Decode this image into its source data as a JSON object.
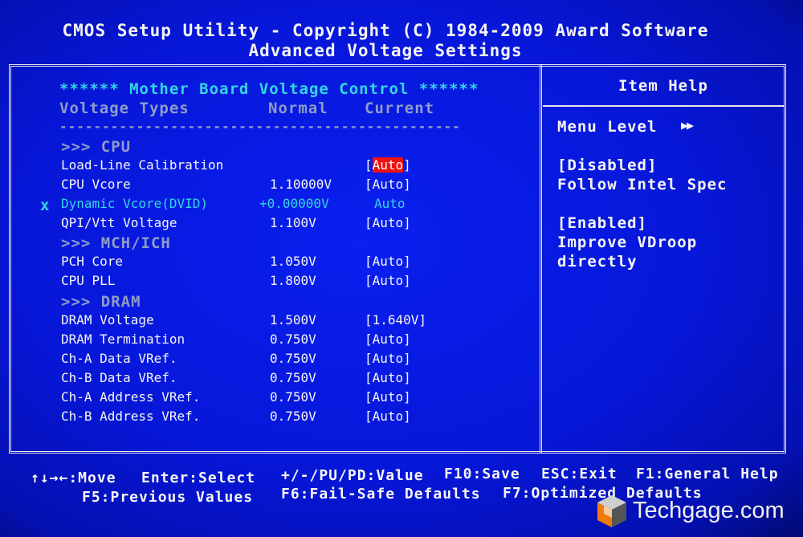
{
  "header": {
    "title": "CMOS Setup Utility - Copyright (C) 1984-2009 Award Software",
    "subtitle": "Advanced Voltage Settings"
  },
  "main": {
    "section_title": "****** Mother Board Voltage Control ******",
    "columns": {
      "type": "Voltage Types",
      "normal": "Normal",
      "current": "Current"
    },
    "separator": "-----------------------------------------------",
    "groups": {
      "cpu": ">>> CPU",
      "mch": ">>> MCH/ICH",
      "dram": ">>> DRAM"
    },
    "items": [
      {
        "label": "Load-Line Calibration",
        "normal": "",
        "current_open": "[",
        "current": "Auto",
        "current_close": "]"
      },
      {
        "label": "CPU Vcore",
        "normal": "1.10000V",
        "current": "[Auto]"
      },
      {
        "marker": "x",
        "label": "Dynamic Vcore(DVID)",
        "normal": "+0.00000V",
        "current": "Auto"
      },
      {
        "label": "QPI/Vtt Voltage",
        "normal": "1.100V",
        "current": "[Auto]"
      },
      {
        "label": "PCH Core",
        "normal": "1.050V",
        "current": "[Auto]"
      },
      {
        "label": "CPU PLL",
        "normal": "1.800V",
        "current": "[Auto]"
      },
      {
        "label": "DRAM Voltage",
        "normal": "1.500V",
        "current": "[1.640V]"
      },
      {
        "label": "DRAM Termination",
        "normal": "0.750V",
        "current": "[Auto]"
      },
      {
        "label": "Ch-A Data VRef.",
        "normal": "0.750V",
        "current": "[Auto]"
      },
      {
        "label": "Ch-B Data VRef.",
        "normal": "0.750V",
        "current": "[Auto]"
      },
      {
        "label": "Ch-A Address VRef.",
        "normal": "0.750V",
        "current": "[Auto]"
      },
      {
        "label": "Ch-B Address VRef.",
        "normal": "0.750V",
        "current": "[Auto]"
      }
    ]
  },
  "help": {
    "title": "Item Help",
    "menu_level": "Menu Level",
    "menu_level_arrows": "▶▶",
    "lines": [
      "[Disabled]",
      "Follow Intel Spec",
      "[Enabled]",
      "Improve VDroop",
      "directly"
    ]
  },
  "footer": {
    "move": "↑↓→←:Move",
    "enter": "Enter:Select",
    "value": "+/-/PU/PD:Value",
    "f10": "F10:Save",
    "esc": "ESC:Exit",
    "f1": "F1:General Help",
    "f5": "F5:Previous Values",
    "f6": "F6:Fail-Safe Defaults",
    "f7": "F7:Optimized Defaults"
  },
  "watermark": {
    "text": "Techgage.com"
  },
  "colors": {
    "background": "#0717d8",
    "highlight": "#ee1111",
    "cyan_text": "#33d6e6",
    "gray_text": "#8f9cc9"
  }
}
